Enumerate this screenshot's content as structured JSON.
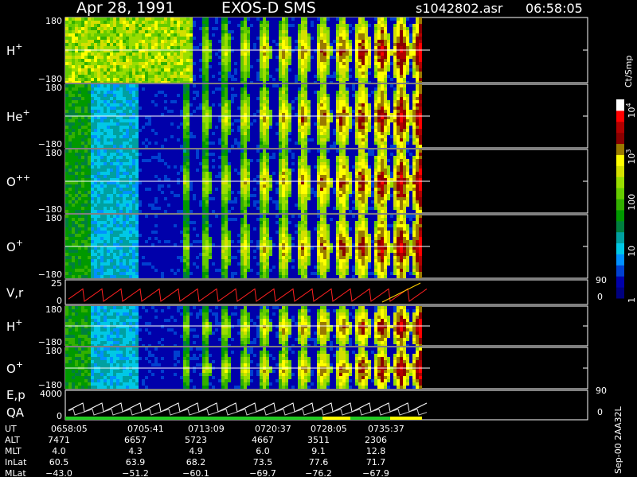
{
  "header": {
    "date": "Apr 28, 1991",
    "instrument": "EXOS-D SMS",
    "file": "s1042802.asr",
    "time": "06:58:05"
  },
  "colorbar": {
    "unit": "Ct/Smp",
    "ticks": [
      {
        "label": "1",
        "value": 1
      },
      {
        "label": "10",
        "value": 10
      },
      {
        "label": "100",
        "value": 100
      },
      {
        "label": "10",
        "sup": "3",
        "value": 1000
      },
      {
        "label": "10",
        "sup": "4",
        "value": 10000
      }
    ],
    "scale": "log",
    "range": [
      1,
      20000
    ],
    "colors": [
      "#00007f",
      "#0000aa",
      "#0040d0",
      "#0090ff",
      "#00c8e6",
      "#00a0a0",
      "#007f3f",
      "#009900",
      "#33b000",
      "#66cc00",
      "#99dd00",
      "#d4e000",
      "#ffff00",
      "#9a7a00",
      "#8a0000",
      "#b00000",
      "#ff0000",
      "#ffffff"
    ]
  },
  "chart_data": [
    {
      "type": "heatmap",
      "panel": "H+",
      "label": "H",
      "sup": "+",
      "ylim": [
        -180,
        180
      ],
      "ticks": [
        "180",
        "−180"
      ],
      "colorscale": "log counts/sample"
    },
    {
      "type": "heatmap",
      "panel": "He+",
      "label": "He",
      "sup": "+",
      "ylim": [
        -180,
        180
      ],
      "ticks": [
        "180",
        "−180"
      ]
    },
    {
      "type": "heatmap",
      "panel": "O++",
      "label": "O",
      "sup": "++",
      "ylim": [
        -180,
        180
      ],
      "ticks": [
        "180",
        "−180"
      ]
    },
    {
      "type": "heatmap",
      "panel": "O+",
      "label": "O",
      "sup": "+",
      "ylim": [
        -180,
        180
      ],
      "ticks": [
        "180",
        "−180"
      ]
    },
    {
      "type": "line",
      "panel": "V,r",
      "label": "V,r",
      "left_ticks": [
        "25",
        "0"
      ],
      "right_ticks": [
        "90",
        "0"
      ],
      "ylim": [
        0,
        25
      ]
    },
    {
      "type": "heatmap",
      "panel": "H+ (lower)",
      "label": "H",
      "sup": "+",
      "ylim": [
        -180,
        180
      ],
      "ticks": [
        "180",
        "−180"
      ]
    },
    {
      "type": "heatmap",
      "panel": "O+ (lower)",
      "label": "O",
      "sup": "+",
      "ylim": [
        -180,
        180
      ],
      "ticks": [
        "180",
        "−180"
      ]
    },
    {
      "type": "line",
      "panel": "E,p / QA",
      "label": "E,p",
      "label2": "QA",
      "left_ticks": [
        "4000",
        "0"
      ],
      "right_ticks": [
        "90",
        "0"
      ],
      "ylim": [
        0,
        4000
      ]
    }
  ],
  "ephemeris": {
    "rows": [
      {
        "name": "UT",
        "values": [
          "0658:05",
          "0705:41",
          "0713:09",
          "0720:37",
          "0728:05",
          "0735:37"
        ]
      },
      {
        "name": "ALT",
        "values": [
          "7471",
          "6657",
          "5723",
          "4667",
          "3511",
          "2306"
        ]
      },
      {
        "name": "MLT",
        "values": [
          "4.0",
          "4.3",
          "4.9",
          "6.0",
          "9.1",
          "12.8"
        ]
      },
      {
        "name": "InLat",
        "values": [
          "60.5",
          "63.9",
          "68.2",
          "73.5",
          "77.6",
          "71.7"
        ]
      },
      {
        "name": "MLat",
        "values": [
          "−43.0",
          "−51.2",
          "−60.1",
          "−69.7",
          "−76.2",
          "−67.9"
        ]
      }
    ]
  },
  "footer": {
    "vertical_label": "Sep-00  2AA32L"
  }
}
